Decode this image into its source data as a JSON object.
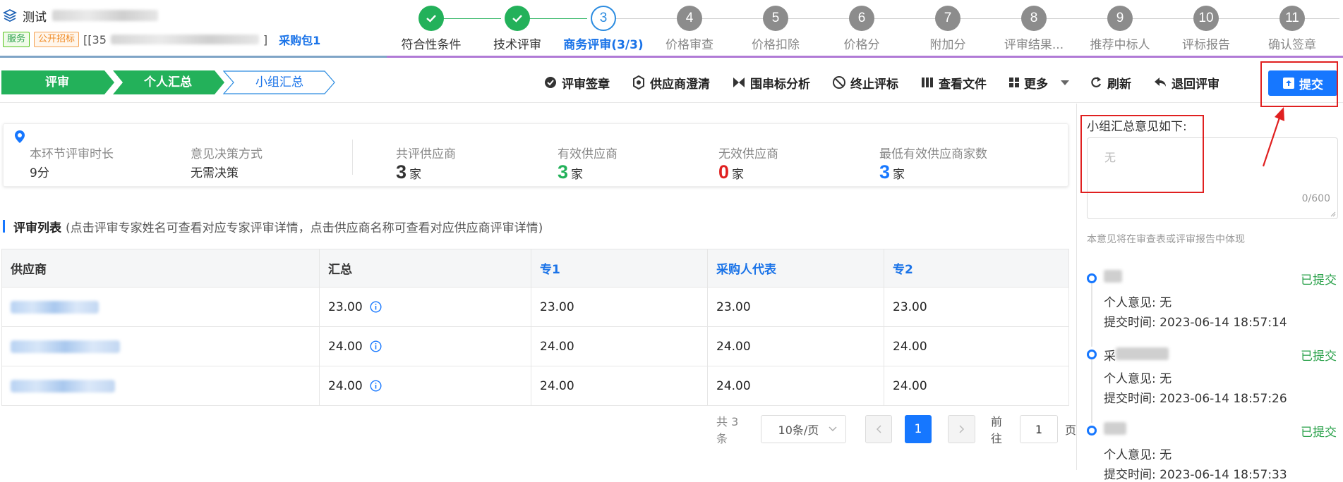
{
  "header": {
    "project_title_prefix": "测试",
    "tags": [
      "服务",
      "公开招标"
    ],
    "code_prefix": "[[35",
    "code_suffix": "]",
    "package": "采购包1"
  },
  "steps": [
    {
      "label": "符合性条件",
      "num": "1",
      "state": "done"
    },
    {
      "label": "技术评审",
      "num": "2",
      "state": "done"
    },
    {
      "label": "商务评审(3/3)",
      "num": "3",
      "state": "active"
    },
    {
      "label": "价格审查",
      "num": "4",
      "state": "todo"
    },
    {
      "label": "价格扣除",
      "num": "5",
      "state": "todo"
    },
    {
      "label": "价格分",
      "num": "6",
      "state": "todo"
    },
    {
      "label": "附加分",
      "num": "7",
      "state": "todo"
    },
    {
      "label": "评审结果...",
      "num": "8",
      "state": "todo"
    },
    {
      "label": "推荐中标人",
      "num": "9",
      "state": "todo"
    },
    {
      "label": "评标报告",
      "num": "10",
      "state": "todo"
    },
    {
      "label": "确认签章",
      "num": "11",
      "state": "todo"
    }
  ],
  "crumbs": [
    "评审",
    "个人汇总",
    "小组汇总"
  ],
  "actions": {
    "sign": "评审签章",
    "clarify": "供应商澄清",
    "collusion": "围串标分析",
    "terminate": "终止评标",
    "files": "查看文件",
    "more": "更多",
    "refresh": "刷新",
    "return": "退回评审",
    "submit": "提交"
  },
  "stats": {
    "duration_label": "本环节评审时长",
    "duration_value": "9分",
    "decision_label": "意见决策方式",
    "decision_value": "无需决策",
    "total_label": "共评供应商",
    "total_value": "3",
    "valid_label": "有效供应商",
    "valid_value": "3",
    "invalid_label": "无效供应商",
    "invalid_value": "0",
    "min_label": "最低有效供应商家数",
    "min_value": "3",
    "unit": "家"
  },
  "list": {
    "title": "评审列表",
    "hint": "(点击评审专家姓名可查看对应专家评审详情，点击供应商名称可查看对应供应商评审详情)",
    "columns": [
      "供应商",
      "汇总",
      "专1",
      "采购人代表",
      "专2"
    ],
    "rows": [
      {
        "summary": "23.00",
        "e1": "23.00",
        "rep": "23.00",
        "e2": "23.00"
      },
      {
        "summary": "24.00",
        "e1": "24.00",
        "rep": "24.00",
        "e2": "24.00"
      },
      {
        "summary": "24.00",
        "e1": "24.00",
        "rep": "24.00",
        "e2": "24.00"
      }
    ]
  },
  "pager": {
    "total": "共 3 条",
    "page_size": "10条/页",
    "current": "1",
    "goto_prefix": "前往",
    "goto_value": "1",
    "goto_suffix": "页"
  },
  "side": {
    "title": "小组汇总意见如下:",
    "placeholder": "无",
    "counter": "0/600",
    "note": "本意见将在审查表或评审报告中体现",
    "records": [
      {
        "name_prefix": "",
        "status": "已提交",
        "opinion_label": "个人意见:",
        "opinion": "无",
        "time_label": "提交时间:",
        "time": "2023-06-14 18:57:14"
      },
      {
        "name_prefix": "采",
        "status": "已提交",
        "opinion_label": "个人意见:",
        "opinion": "无",
        "time_label": "提交时间:",
        "time": "2023-06-14 18:57:26"
      },
      {
        "name_prefix": "",
        "status": "已提交",
        "opinion_label": "个人意见:",
        "opinion": "无",
        "time_label": "提交时间:",
        "time": "2023-06-14 18:57:33"
      }
    ]
  },
  "colors": {
    "accent": "#1677ff",
    "success": "#23b15a",
    "danger": "#e02020"
  }
}
